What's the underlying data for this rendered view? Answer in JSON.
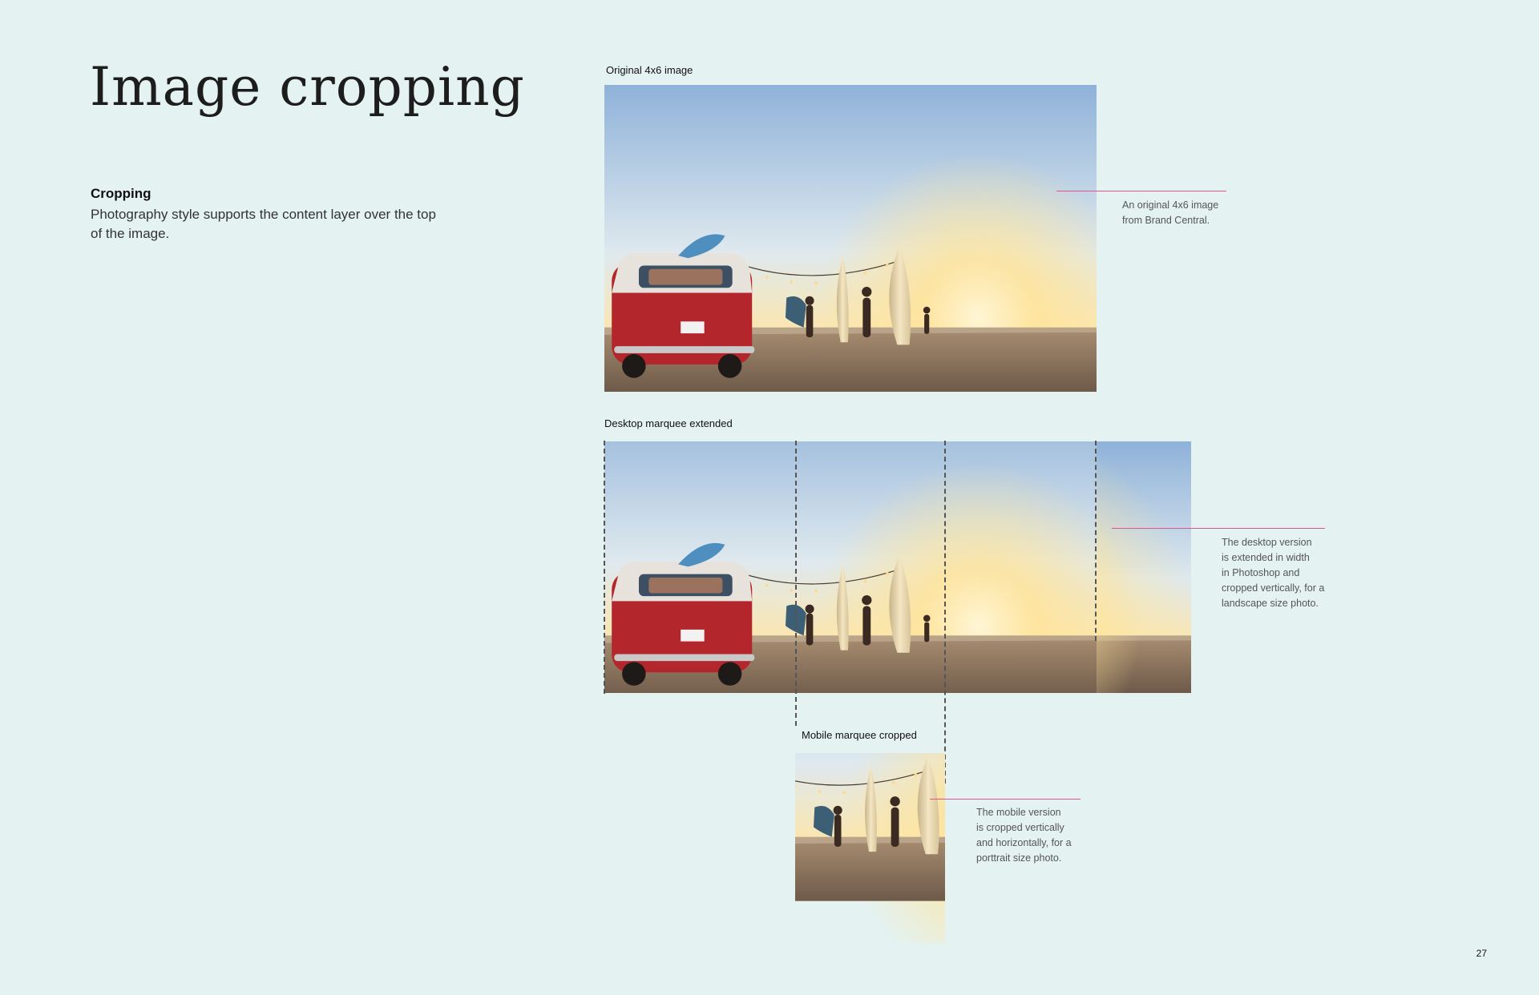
{
  "page": {
    "title": "Image cropping",
    "page_number": "27"
  },
  "section": {
    "heading": "Cropping",
    "body": "Photography style supports the content layer over the top of the image."
  },
  "original": {
    "caption": "Original 4x6 image",
    "note_line1": "An original 4x6 image",
    "note_line2": "from Brand Central."
  },
  "desktop": {
    "caption": "Desktop marquee extended",
    "note_line1": "The desktop version",
    "note_line2": "is extended in width",
    "note_line3": "in Photoshop and",
    "note_line4": "cropped vertically, for a",
    "note_line5": "landscape size photo."
  },
  "mobile": {
    "caption": "Mobile marquee cropped",
    "note_line1": "The mobile version",
    "note_line2": "is cropped vertically",
    "note_line3": "and horizontally, for a",
    "note_line4": "porttrait size photo."
  },
  "colors": {
    "background": "#e4f2f1",
    "accent_line": "#e0558f",
    "guide": "#555555",
    "van_red": "#b3262c",
    "sky_top": "#8fb2d9",
    "sun_glow": "#ffd77a",
    "sand": "#8a7564"
  }
}
